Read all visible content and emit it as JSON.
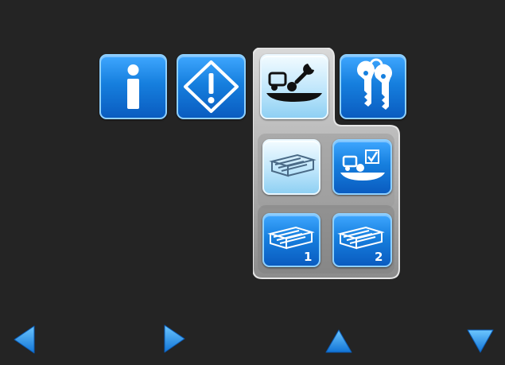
{
  "screen": {
    "background": "#242424",
    "accent": "#1a86e6",
    "selected_tile": "#bfe6fb",
    "panel": "#b3b3b3"
  },
  "menu": {
    "items": [
      {
        "id": "info",
        "icon": "info-icon",
        "selected": false
      },
      {
        "id": "warning",
        "icon": "warning-icon",
        "selected": false
      },
      {
        "id": "scale-service",
        "icon": "scale-wrench-icon",
        "selected": true
      },
      {
        "id": "keys",
        "icon": "keys-icon",
        "selected": false
      }
    ]
  },
  "submenu": {
    "items": [
      {
        "id": "pallet-select",
        "icon": "pallet-icon",
        "selected": true
      },
      {
        "id": "scale-check",
        "icon": "scale-check-icon",
        "selected": false
      },
      {
        "id": "pallet-1",
        "icon": "pallet-icon",
        "label": "1",
        "selected": false
      },
      {
        "id": "pallet-2",
        "icon": "pallet-icon",
        "label": "2",
        "selected": false
      }
    ]
  },
  "navigation": {
    "left": "left-arrow-icon",
    "right": "right-arrow-icon",
    "up": "up-arrow-icon",
    "down": "down-arrow-icon"
  }
}
